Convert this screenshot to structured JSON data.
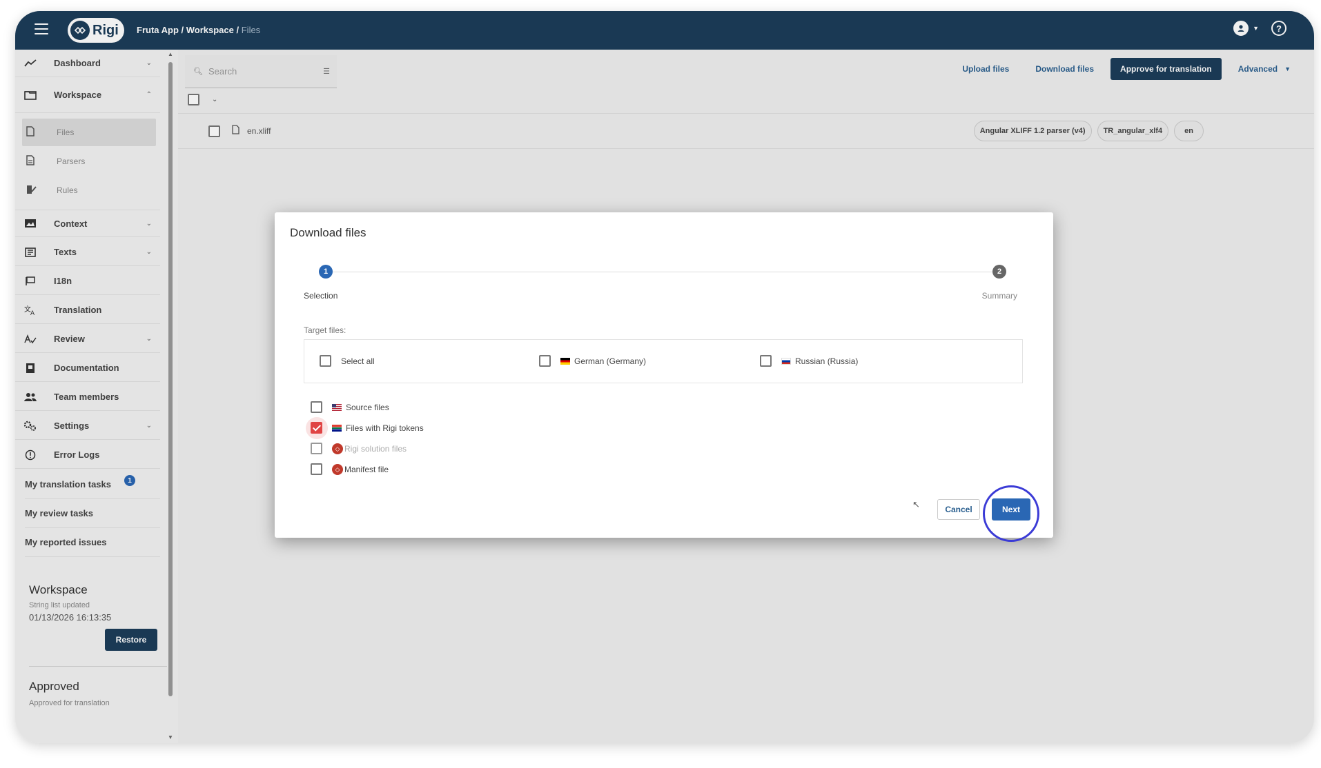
{
  "header": {
    "app_name": "Rigi",
    "breadcrumb": [
      "Fruta App",
      "Workspace",
      "Files"
    ]
  },
  "sidebar": {
    "items": [
      {
        "label": "Dashboard",
        "icon": "dashboard-icon",
        "expandable": true
      },
      {
        "label": "Workspace",
        "icon": "folder-icon",
        "expandable": true,
        "expanded": true
      },
      {
        "label": "Files",
        "icon": "file-icon"
      },
      {
        "label": "Parsers",
        "icon": "parser-icon"
      },
      {
        "label": "Rules",
        "icon": "rules-icon"
      },
      {
        "label": "Context",
        "icon": "image-icon",
        "expandable": true
      },
      {
        "label": "Texts",
        "icon": "texts-icon",
        "expandable": true
      },
      {
        "label": "I18n",
        "icon": "flag-icon"
      },
      {
        "label": "Translation",
        "icon": "translate-icon"
      },
      {
        "label": "Review",
        "icon": "review-icon",
        "expandable": true
      },
      {
        "label": "Documentation",
        "icon": "book-icon"
      },
      {
        "label": "Team members",
        "icon": "people-icon"
      },
      {
        "label": "Settings",
        "icon": "gears-icon",
        "expandable": true
      },
      {
        "label": "Error Logs",
        "icon": "alert-icon"
      }
    ],
    "links": [
      {
        "label": "My translation tasks",
        "badge": "1"
      },
      {
        "label": "My review tasks"
      },
      {
        "label": "My reported issues"
      }
    ],
    "workspace_status": {
      "title": "Workspace",
      "subtitle": "String list updated",
      "date": "01/13/2026 16:13:35",
      "restore_label": "Restore"
    },
    "approved_status": {
      "title": "Approved",
      "subtitle": "Approved for translation"
    }
  },
  "main": {
    "search_placeholder": "Search",
    "toolbar": {
      "upload": "Upload files",
      "download": "Download files",
      "approve": "Approve for translation",
      "advanced": "Advanced"
    },
    "files": [
      {
        "name": "en.xliff",
        "chips": [
          "Angular XLIFF 1.2 parser (v4)",
          "TR_angular_xlf4",
          "en"
        ]
      }
    ]
  },
  "dialog": {
    "title": "Download files",
    "steps": [
      {
        "number": "1",
        "label": "Selection",
        "active": true
      },
      {
        "number": "2",
        "label": "Summary",
        "active": false
      }
    ],
    "target_label": "Target files:",
    "target_options": [
      {
        "label": "Select all",
        "flag": "",
        "checked": false
      },
      {
        "label": "German (Germany)",
        "flag": "de",
        "checked": false
      },
      {
        "label": "Russian (Russia)",
        "flag": "ru",
        "checked": false
      }
    ],
    "file_options": [
      {
        "label": "Source files",
        "icon": "us-flag-icon",
        "checked": false,
        "disabled": false
      },
      {
        "label": "Files with Rigi tokens",
        "icon": "za-flag-icon",
        "checked": true,
        "disabled": false
      },
      {
        "label": "Rigi solution files",
        "icon": "rigi-logo-icon",
        "checked": false,
        "disabled": true
      },
      {
        "label": "Manifest file",
        "icon": "rigi-logo-icon",
        "checked": false,
        "disabled": false
      }
    ],
    "cancel_label": "Cancel",
    "next_label": "Next"
  }
}
